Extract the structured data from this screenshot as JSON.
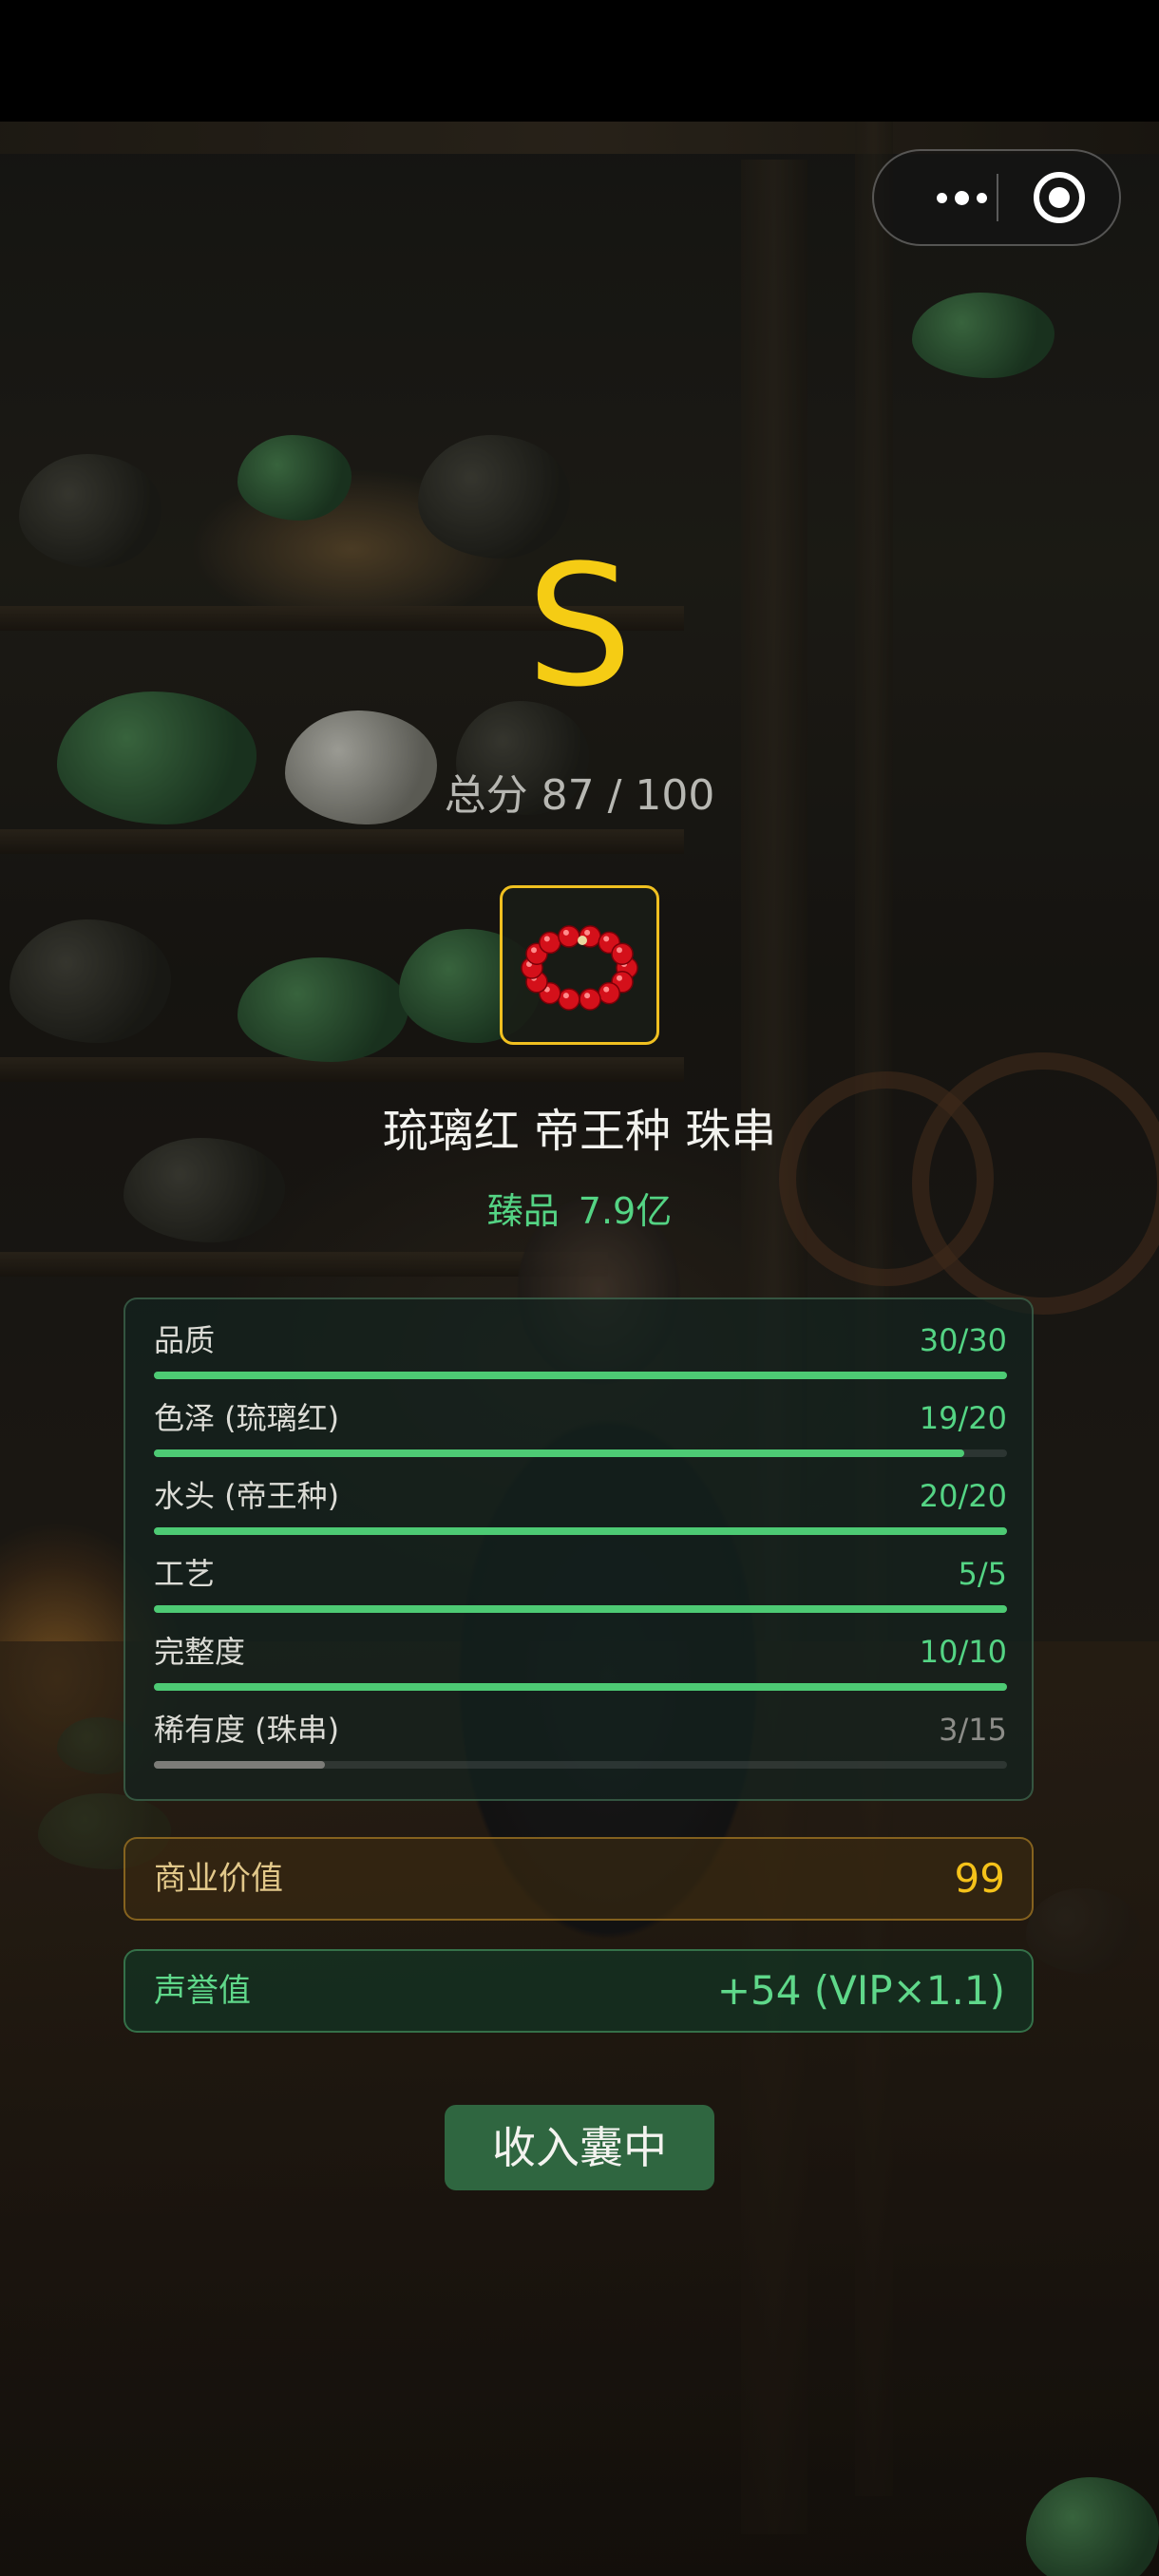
{
  "result": {
    "grade": "S",
    "score_text": "总分 87 / 100",
    "item_name": "琉璃红 帝王种 珠串",
    "tier": "臻品",
    "price": "7.9亿"
  },
  "stats": [
    {
      "label": "品质",
      "value": "30/30",
      "fraction": 1.0,
      "color": "#4dca74"
    },
    {
      "label": "色泽 (琉璃红)",
      "value": "19/20",
      "fraction": 0.95,
      "color": "#4dca74"
    },
    {
      "label": "水头 (帝王种)",
      "value": "20/20",
      "fraction": 1.0,
      "color": "#4dca74"
    },
    {
      "label": "工艺",
      "value": "5/5",
      "fraction": 1.0,
      "color": "#4dca74"
    },
    {
      "label": "完整度",
      "value": "10/10",
      "fraction": 1.0,
      "color": "#4dca74"
    },
    {
      "label": "稀有度 (珠串)",
      "value": "3/15",
      "fraction": 0.2,
      "color": "#7c7c78"
    }
  ],
  "commercial": {
    "label": "商业价值",
    "value": "99"
  },
  "reputation": {
    "label": "声誉值",
    "value": "+54 (VIP×1.1)"
  },
  "actions": {
    "collect_label": "收入囊中"
  },
  "capsule": {
    "more_icon": "more-dots-icon",
    "close_icon": "target-circle-icon"
  },
  "colors": {
    "grade": "#f5cc14",
    "accent_green": "#54d484",
    "gold": "#f5c21a",
    "button": "#2f6640"
  }
}
